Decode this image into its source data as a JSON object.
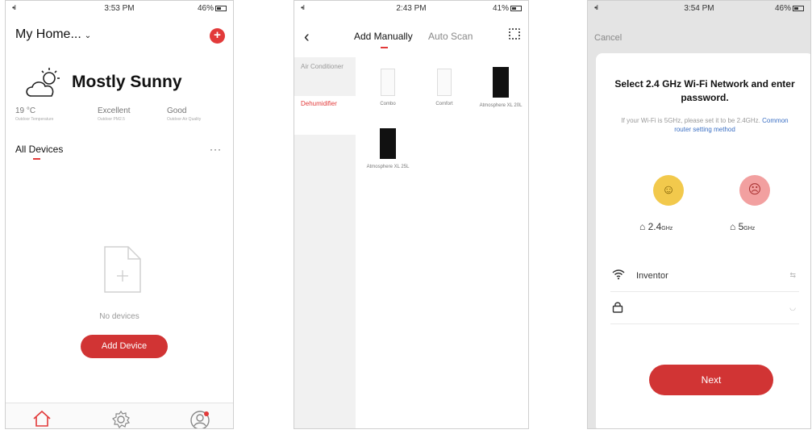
{
  "screen1": {
    "status": {
      "signal": "•ıl",
      "time": "3:53 PM",
      "battery": "46%"
    },
    "home_title": "My Home...",
    "add_icon": "plus-circle-icon",
    "weather": {
      "icon": "partly-sunny-icon",
      "text": "Mostly Sunny"
    },
    "stats": [
      {
        "value": "19 °C",
        "label": "Outdoor Temperature"
      },
      {
        "value": "Excellent",
        "label": "Outdoor PM2.5"
      },
      {
        "value": "Good",
        "label": "Outdoor Air Quality"
      }
    ],
    "section_title": "All Devices",
    "more": "···",
    "empty_text": "No devices",
    "add_button": "Add Device",
    "tabbar": [
      {
        "icon": "home-icon"
      },
      {
        "icon": "gear-icon"
      },
      {
        "icon": "profile-icon"
      }
    ],
    "accent": "#e23a3a"
  },
  "screen2": {
    "status": {
      "signal": "•ıl",
      "time": "2:43 PM",
      "battery": "41%"
    },
    "back": "‹",
    "tabs": {
      "manual": "Add Manually",
      "auto": "Auto Scan"
    },
    "categories": [
      {
        "label": "Air Conditioner",
        "active": false
      },
      {
        "label": "Dehumidifier",
        "active": true
      }
    ],
    "products": [
      {
        "name": "Combo",
        "color": "white"
      },
      {
        "name": "Comfort",
        "color": "white"
      },
      {
        "name": "Atmosphere XL 20L",
        "color": "black"
      },
      {
        "name": "Atmosphere XL 25L",
        "color": "black"
      }
    ]
  },
  "screen3": {
    "status": {
      "signal": "•ıl",
      "time": "3:54 PM",
      "battery": "46%"
    },
    "cancel": "Cancel",
    "title": "Select 2.4 GHz Wi-Fi Network and enter password.",
    "hint": "If your Wi-Fi is 5GHz, please set it to be 2.4GHz.",
    "hint_link": "Common router setting method",
    "bands": [
      {
        "face": "☺",
        "main": "2.4",
        "unit": "GHz"
      },
      {
        "face": "☹",
        "main": "5",
        "unit": "GHz"
      }
    ],
    "wifi_icon": "wifi-icon",
    "network_name": "Inventor",
    "lock_icon": "lock-icon",
    "password": "",
    "next_button": "Next"
  }
}
